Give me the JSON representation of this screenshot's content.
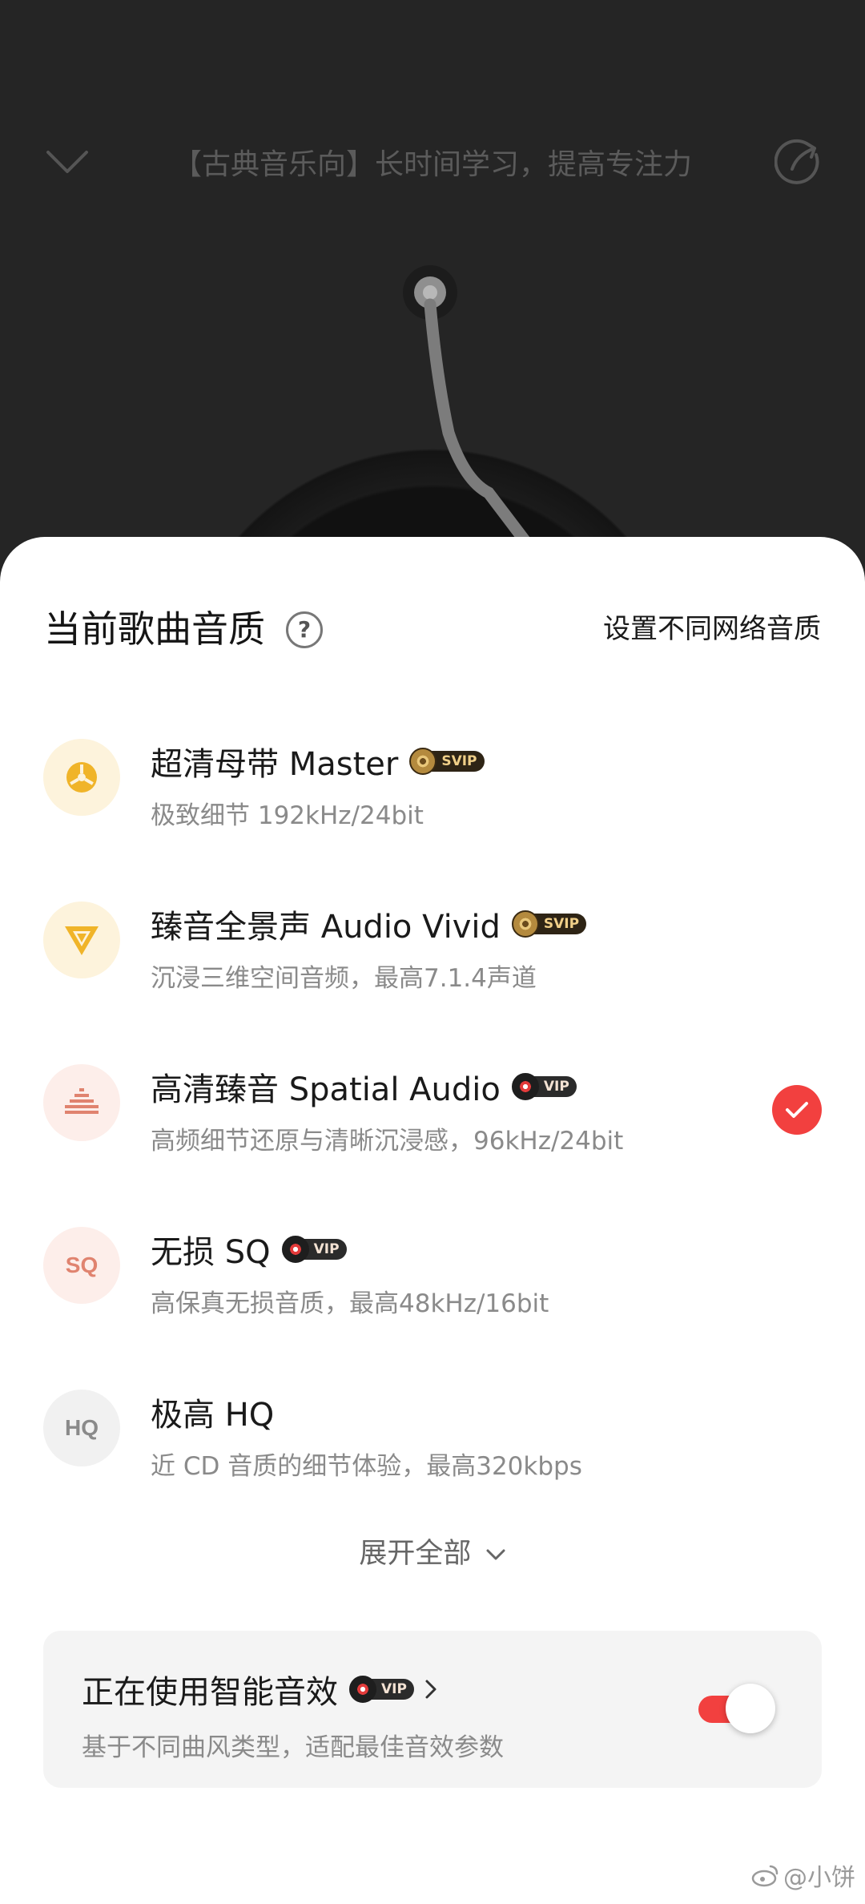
{
  "player": {
    "title": "【古典音乐向】长时间学习，提高专注力"
  },
  "sheet": {
    "title": "当前歌曲音质",
    "help_label": "?",
    "network_setting_label": "设置不同网络音质"
  },
  "qualities": [
    {
      "name": "超清母带  Master",
      "badge": "SVIP",
      "desc": "极致细节 192kHz/24bit",
      "icon": "master-icon",
      "selected": false
    },
    {
      "name": "臻音全景声  Audio Vivid",
      "badge": "SVIP",
      "desc": "沉浸三维空间音频，最高7.1.4声道",
      "icon": "audio-vivid-icon",
      "selected": false
    },
    {
      "name": "高清臻音  Spatial Audio",
      "badge": "VIP",
      "desc": "高频细节还原与清晰沉浸感，96kHz/24bit",
      "icon": "spatial-audio-icon",
      "selected": true
    },
    {
      "name": "无损  SQ",
      "badge": "VIP",
      "desc": "高保真无损音质，最高48kHz/16bit",
      "icon": "sq-icon",
      "icon_text": "SQ",
      "selected": false
    },
    {
      "name": "极高  HQ",
      "badge": "",
      "desc": "近 CD 音质的细节体验，最高320kbps",
      "icon": "hq-icon",
      "icon_text": "HQ",
      "selected": false
    }
  ],
  "expand_label": "展开全部",
  "smart_effect": {
    "title": "正在使用智能音效",
    "badge": "VIP",
    "desc": "基于不同曲风类型，适配最佳音效参数",
    "enabled": true
  },
  "watermark": "@小饼",
  "colors": {
    "accent": "#f2403f",
    "gold_icon_bg": "#fdf3dc",
    "red_icon_bg": "#fdeeea",
    "gray_icon_bg": "#f1f1f1"
  }
}
